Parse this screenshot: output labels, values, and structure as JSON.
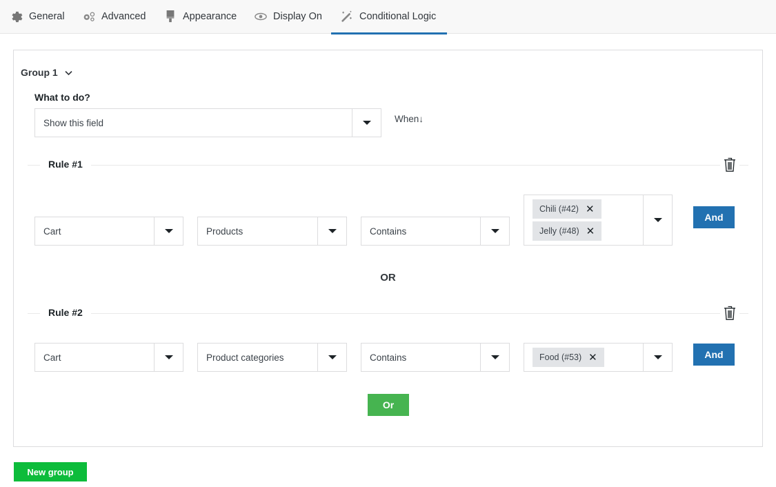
{
  "tabs": [
    {
      "label": "General",
      "icon": "gear-icon"
    },
    {
      "label": "Advanced",
      "icon": "gears-icon"
    },
    {
      "label": "Appearance",
      "icon": "paint-brush-icon"
    },
    {
      "label": "Display On",
      "icon": "eye-icon"
    },
    {
      "label": "Conditional Logic",
      "icon": "magic-wand-icon",
      "active": true
    }
  ],
  "group": {
    "title": "Group 1",
    "what_to_do_label": "What to do?",
    "action": "Show this field",
    "when_label": "When↓",
    "rules": [
      {
        "label": "Rule #1",
        "subject": "Cart",
        "field": "Products",
        "operator": "Contains",
        "values": [
          "Chili (#42)",
          "Jelly (#48)"
        ],
        "and_label": "And"
      },
      {
        "label": "Rule #2",
        "subject": "Cart",
        "field": "Product categories",
        "operator": "Contains",
        "values": [
          "Food (#53)"
        ],
        "and_label": "And"
      }
    ],
    "or_separator": "OR",
    "or_button": "Or"
  },
  "new_group_button": "New group",
  "colors": {
    "accent": "#2271b1",
    "or_button": "#46b450",
    "new_group": "#0dbc3b"
  }
}
